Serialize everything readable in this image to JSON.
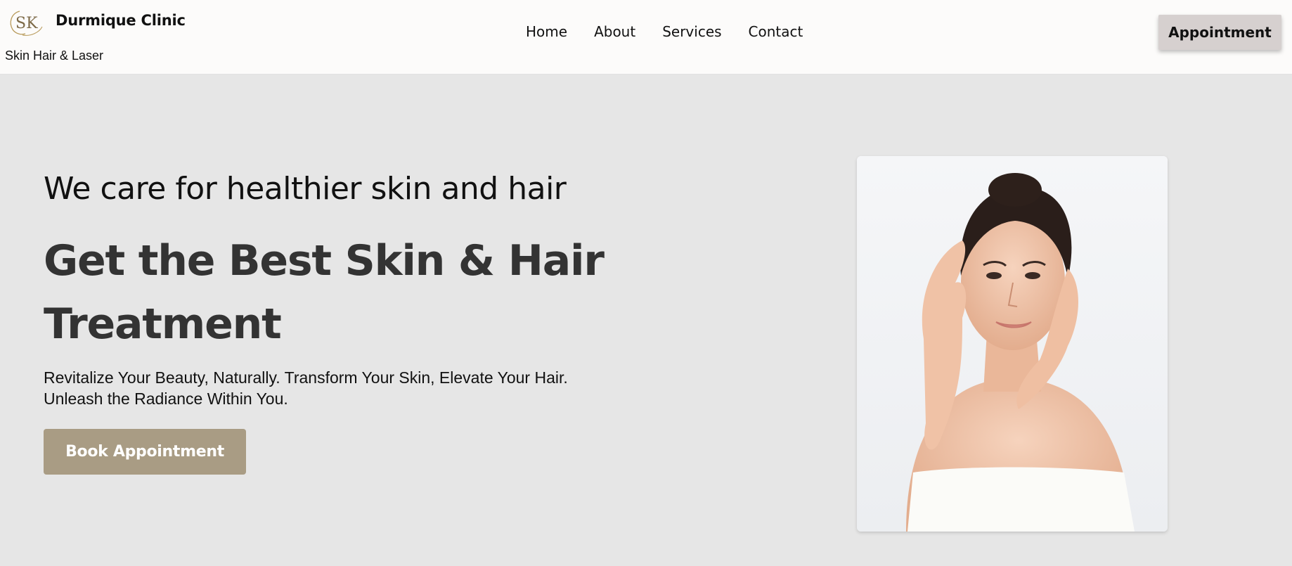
{
  "header": {
    "logo_text": "SK",
    "brand_name": "Durmique Clinic",
    "tagline": "Skin Hair & Laser",
    "nav": [
      {
        "label": "Home"
      },
      {
        "label": "About"
      },
      {
        "label": "Services"
      },
      {
        "label": "Contact"
      }
    ],
    "appointment_label": "Appointment"
  },
  "hero": {
    "subtitle": "We care for healthier skin and hair",
    "title": "Get the Best Skin & Hair Treatment",
    "description_line1": "Revitalize Your Beauty, Naturally. Transform Your Skin, Elevate Your Hair.",
    "description_line2": "Unleash the Radiance Within You.",
    "cta_label": "Book Appointment",
    "image_subject": "woman-portrait"
  },
  "colors": {
    "page_background": "#e6e6e6",
    "header_background": "#fcfbfa",
    "appointment_button": "#d6d0cf",
    "cta_button": "#a99c84",
    "logo_gold": "#b89a5a",
    "title_text": "#333333"
  }
}
